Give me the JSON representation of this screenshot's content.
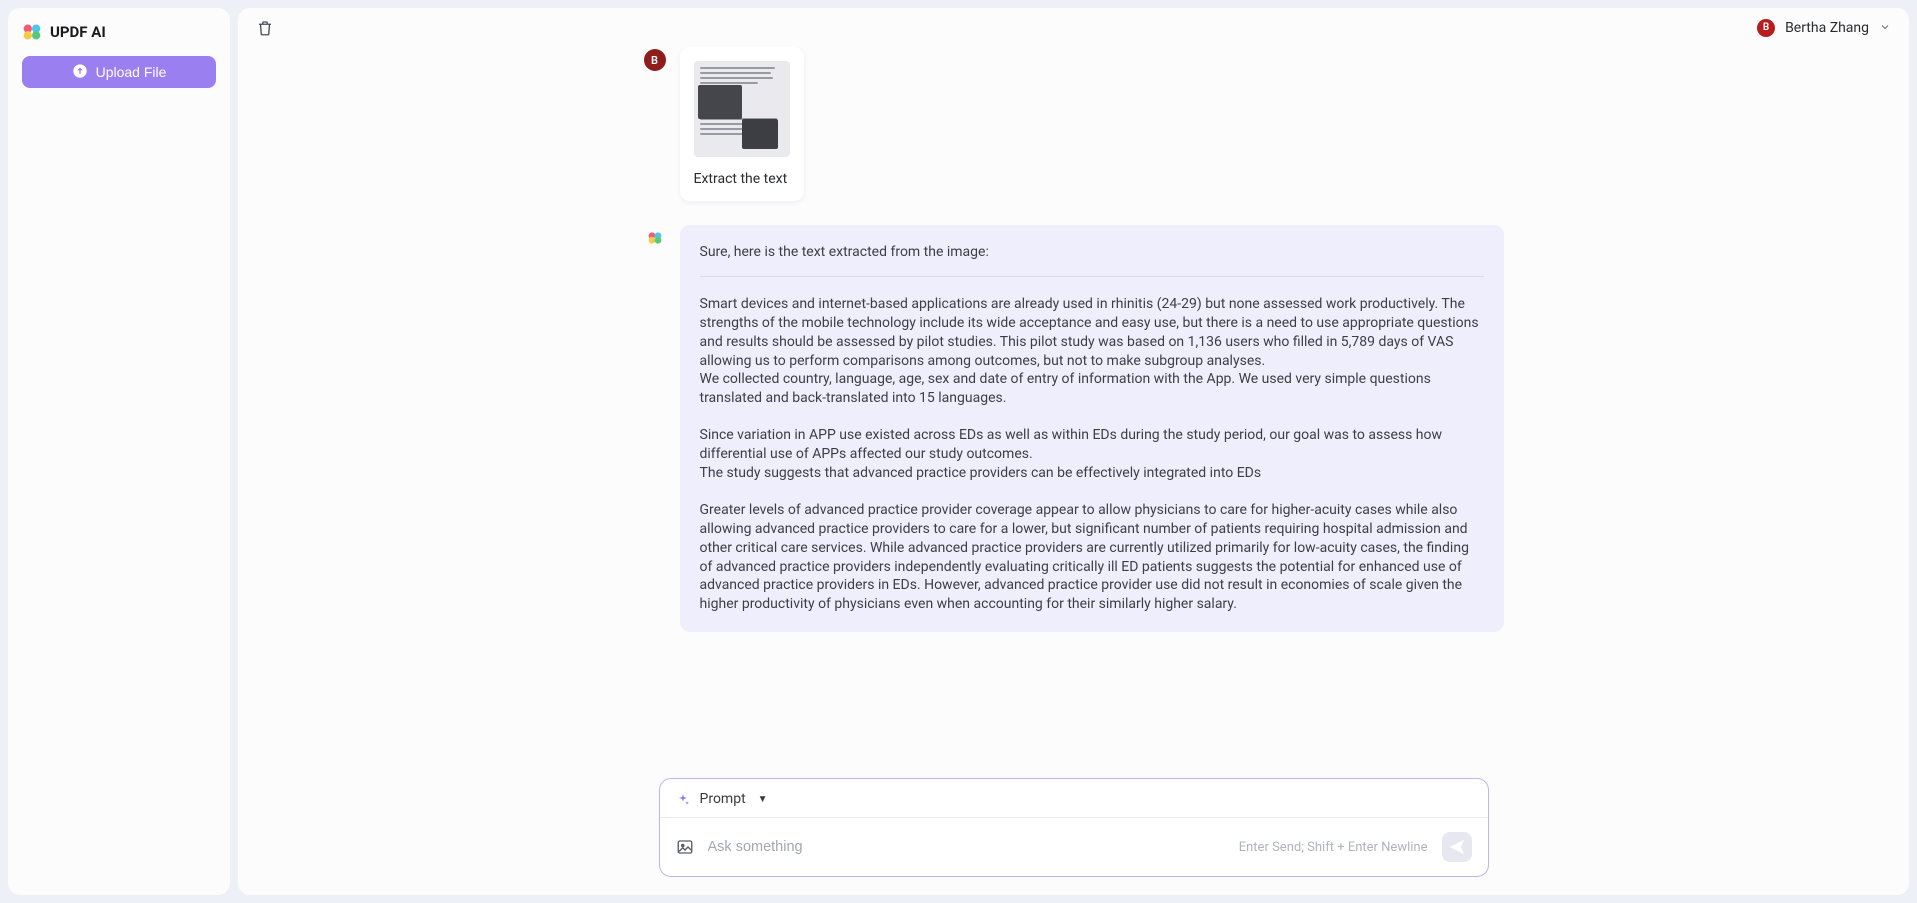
{
  "app": {
    "title": "UPDF AI"
  },
  "sidebar": {
    "upload_label": "Upload File"
  },
  "header": {
    "user_initial": "B",
    "user_name": "Bertha Zhang"
  },
  "chat": {
    "user_msg": {
      "avatar_initial": "B",
      "caption": "Extract the text"
    },
    "ai_msg": {
      "intro": "Sure, here is the text extracted from the image:",
      "para1": "Smart devices and internet-based applications are already used in rhinitis (24-29) but none assessed work productively. The strengths of the mobile technology include its wide acceptance and easy use, but there is a need to use appropriate questions and results should be assessed by pilot studies. This pilot study was based on 1,136 users who filled in 5,789 days of VAS allowing us to perform comparisons among outcomes, but not to make subgroup analyses.\nWe collected country, language, age, sex and date of entry of information with the App. We used very simple questions translated and back-translated into 15 languages.",
      "para2": "Since variation in APP use existed across EDs as well as within EDs during the study period, our goal was to assess how differential use of APPs affected our study outcomes.\nThe study suggests that advanced practice providers can be effectively integrated into EDs",
      "para3": "Greater levels of advanced practice provider coverage appear to allow physicians to care for higher-acuity cases while also allowing advanced practice providers to care for a lower, but significant number of patients requiring hospital admission and other critical care services. While advanced practice providers are currently utilized primarily for low-acuity cases, the finding of advanced practice providers independently evaluating critically ill ED patients suggests the potential for enhanced use of advanced practice providers in EDs. However, advanced practice provider use did not result in economies of scale given the higher productivity of physicians even when accounting for their similarly higher salary."
    }
  },
  "input": {
    "prompt_label": "Prompt",
    "placeholder": "Ask something",
    "hint": "Enter Send; Shift + Enter Newline"
  }
}
